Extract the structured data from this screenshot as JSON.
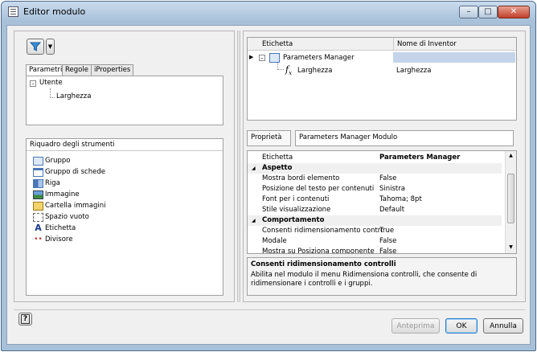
{
  "window": {
    "title": "Editor modulo"
  },
  "tabs": [
    "Parametri",
    "Regole",
    "iProperties"
  ],
  "params_tree": {
    "root": "Utente",
    "child": "Larghezza"
  },
  "toolbox": {
    "title": "Riquadro degli strumenti",
    "items": [
      "Gruppo",
      "Gruppo di schede",
      "Riga",
      "Immagine",
      "Cartella immagini",
      "Spazio vuoto",
      "Etichetta",
      "Divisore"
    ]
  },
  "grid": {
    "col1": "Etichetta",
    "col2": "Nome di Inventor",
    "row1": "Parameters Manager",
    "row2_label": "Larghezza",
    "row2_name": "Larghezza"
  },
  "props": {
    "label": "Proprietà",
    "combo": "Parameters Manager Modulo",
    "rows": [
      {
        "k": "Etichetta",
        "v": "Parameters Manager",
        "bold": true
      },
      {
        "k": "Aspetto",
        "cat": true
      },
      {
        "k": "Mostra bordi elemento",
        "v": "False"
      },
      {
        "k": "Posizione del testo per contenuti",
        "v": "Sinistra"
      },
      {
        "k": "Font per i contenuti",
        "v": "Tahoma; 8pt"
      },
      {
        "k": "Stile visualizzazione",
        "v": "Default"
      },
      {
        "k": "Comportamento",
        "cat": true
      },
      {
        "k": "Consenti ridimensionamento controlli",
        "v": "True"
      },
      {
        "k": "Modale",
        "v": "False"
      },
      {
        "k": "Mostra su Posiziona componente",
        "v": "False"
      }
    ]
  },
  "help": {
    "title": "Consenti ridimensionamento controlli",
    "text": "Abilita nel modulo il menu Ridimensiona controlli, che consente di ridimensionare i controlli e i gruppi."
  },
  "buttons": {
    "preview": "Anteprima",
    "ok": "OK",
    "cancel": "Annulla"
  }
}
